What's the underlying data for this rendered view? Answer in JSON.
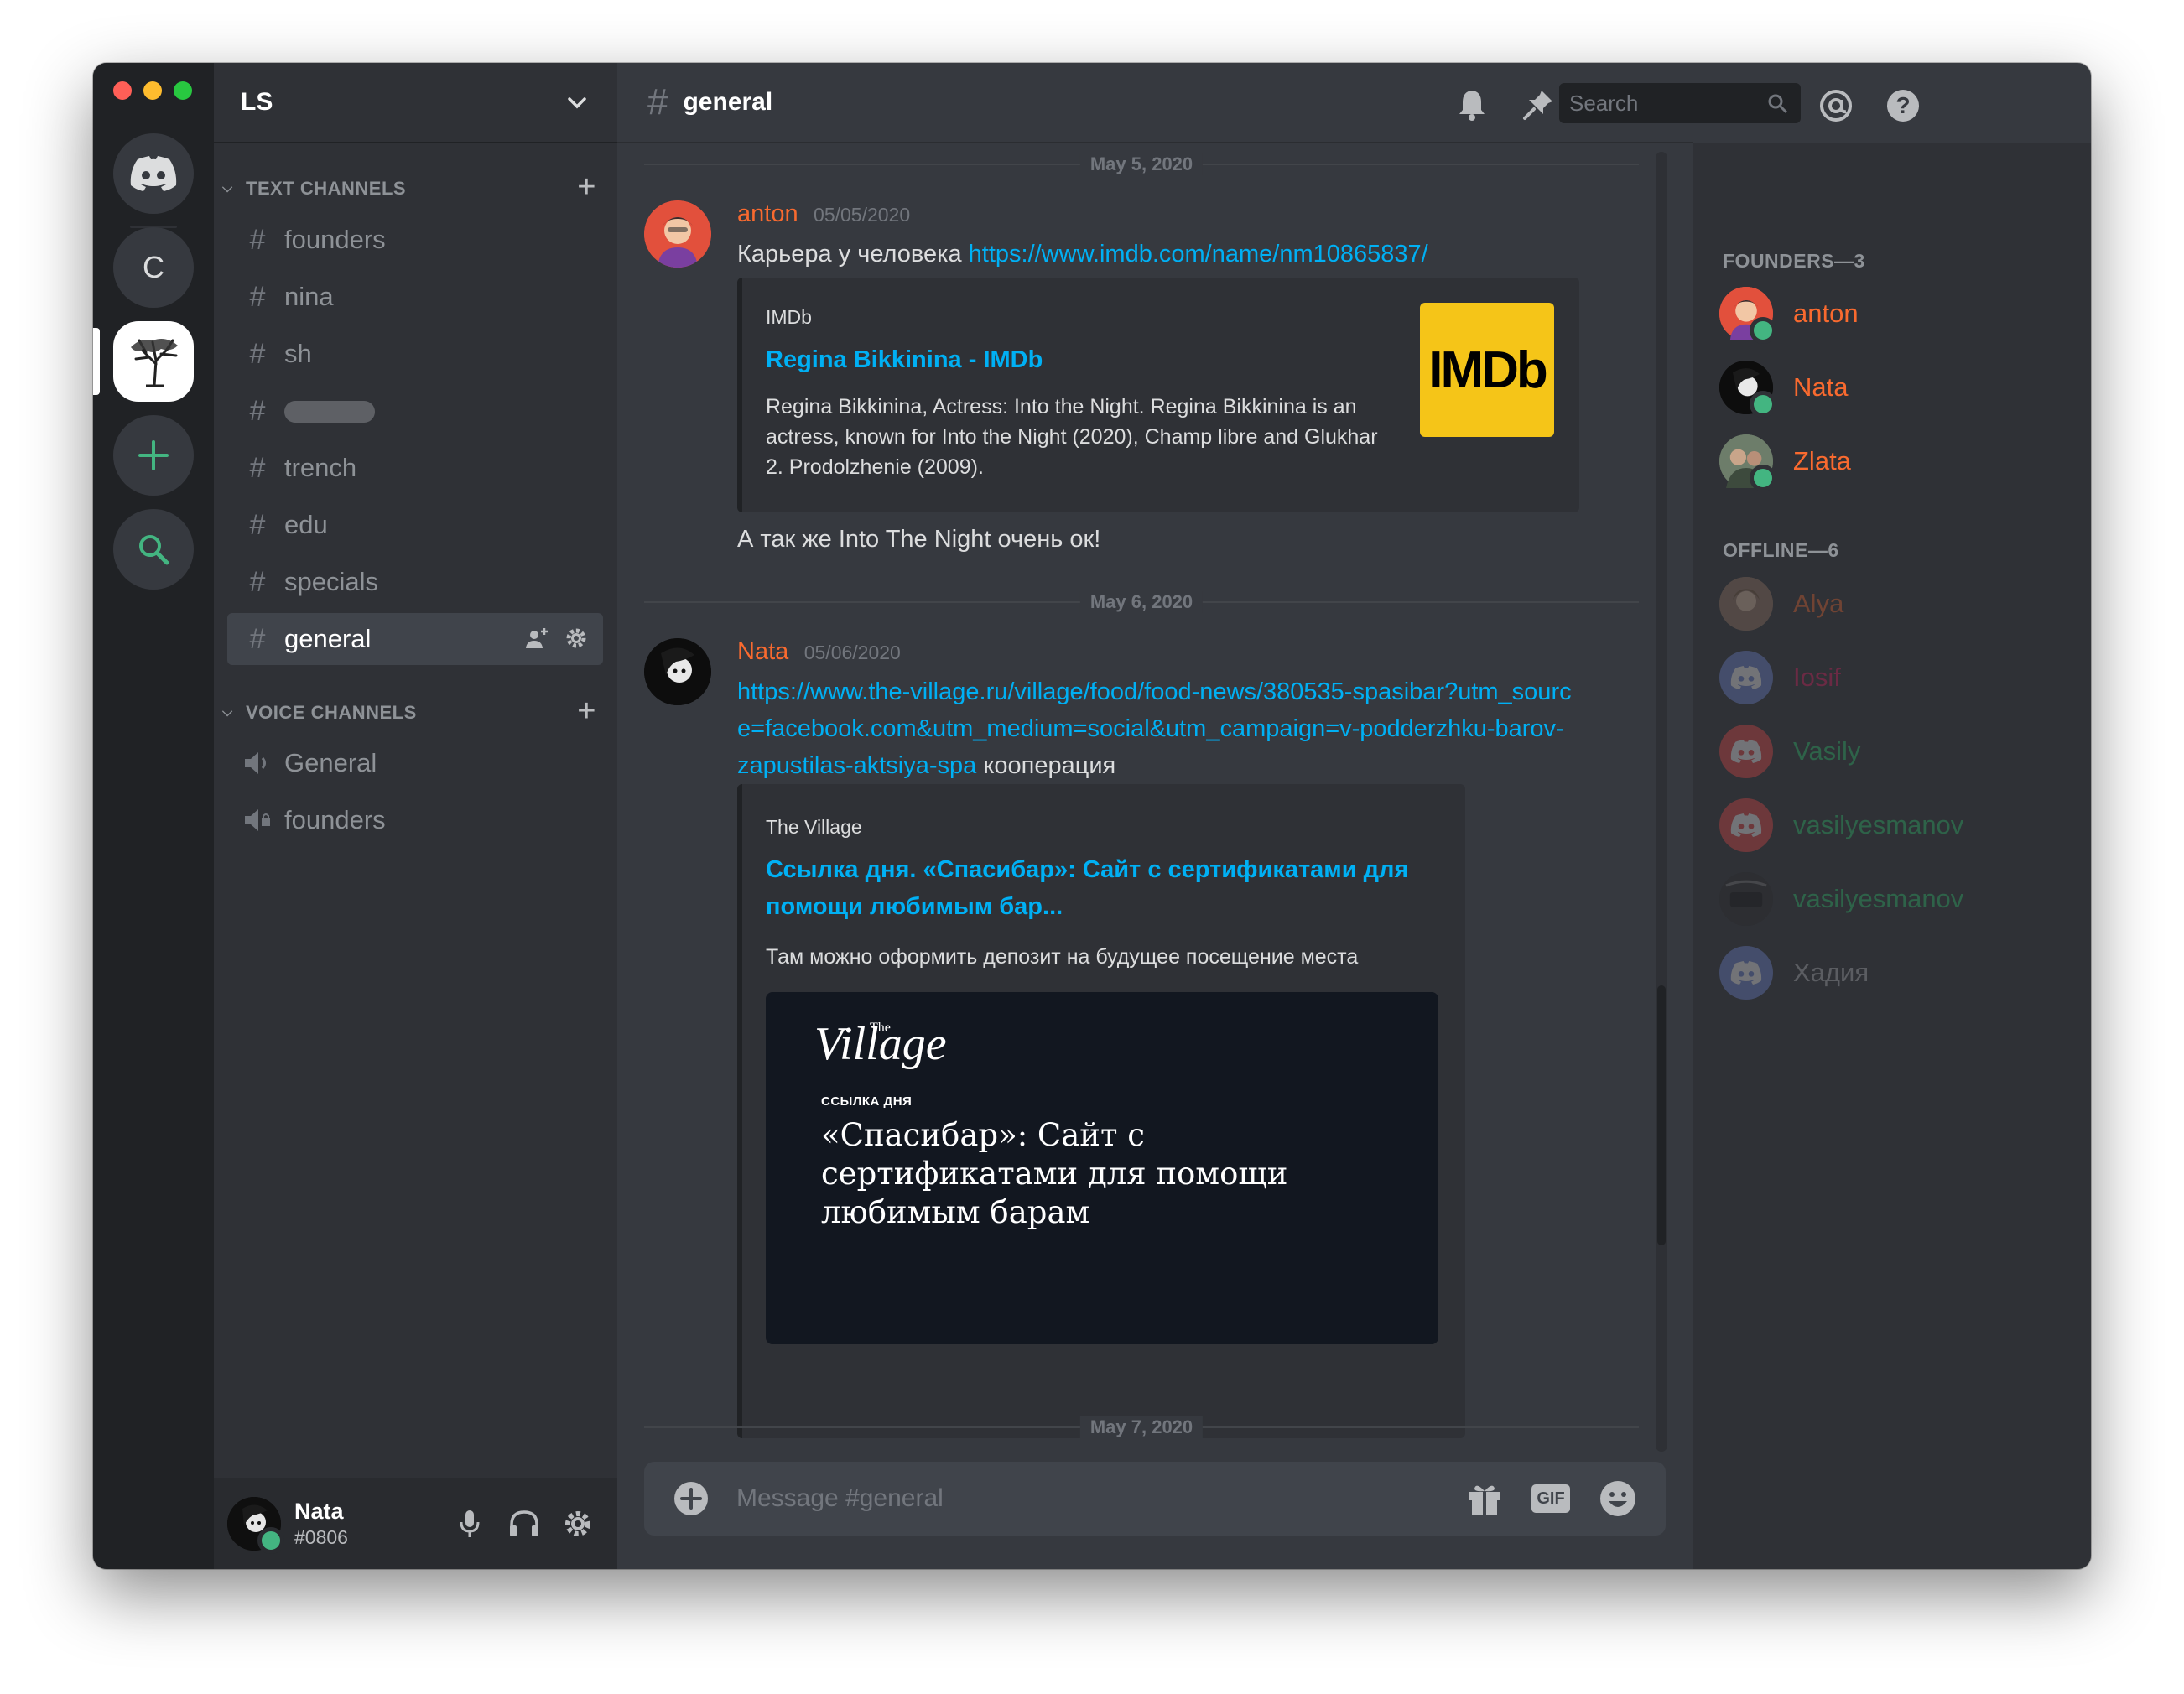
{
  "server": {
    "name": "LS"
  },
  "rail": {
    "server_c_label": "C"
  },
  "categories": {
    "text": "TEXT CHANNELS",
    "voice": "VOICE CHANNELS"
  },
  "text_channels": [
    "founders",
    "nina",
    "sh",
    "",
    "trench",
    "edu",
    "specials",
    "general"
  ],
  "voice_channels": [
    "General",
    "founders"
  ],
  "current_user": {
    "name": "Nata",
    "tag": "#0806"
  },
  "chat": {
    "channel_name": "general",
    "search_placeholder": "Search",
    "composer_placeholder": "Message #general",
    "gif_label": "GIF"
  },
  "messages": {
    "date1": "May 5, 2020",
    "m1": {
      "author": "anton",
      "timestamp": "05/05/2020",
      "text_prefix": "Карьера у человека ",
      "link": "https://www.imdb.com/name/nm10865837/",
      "embed": {
        "provider": "IMDb",
        "title": "Regina Bikkinina - IMDb",
        "description": "Regina Bikkinina, Actress: Into the Night. Regina Bikkinina is an actress, known for Into the Night (2020), Champ libre and Glukhar 2. Prodolzhenie (2009).",
        "thumb_text": "IMDb"
      },
      "followup": "А так же Into The Night очень ок!"
    },
    "date2": "May 6, 2020",
    "m2": {
      "author": "Nata",
      "timestamp": "05/06/2020",
      "link": "https://www.the-village.ru/village/food/food-news/380535-spasibar?utm_source=facebook.com&utm_medium=social&utm_campaign=v-podderzhku-barov-zapustilas-aktsiya-spa",
      "text_suffix": " кооперация",
      "embed": {
        "provider": "The Village",
        "title": "Ссылка дня. «Спасибар»: Сайт с сертификатами для помощи любимым бар...",
        "description": "Там можно оформить депозит на будущее посещение места",
        "image_logo": "Village",
        "image_logo_small": "The",
        "image_kicker": "ССЫЛКА ДНЯ",
        "image_headline": "«Спасибар»: Сайт с сертификатами для помощи любимым барам"
      }
    },
    "date3": "May 7, 2020"
  },
  "members": {
    "founders_header": "FOUNDERS—3",
    "founders": [
      "anton",
      "Nata",
      "Zlata"
    ],
    "offline_header": "OFFLINE—6",
    "offline": [
      "Alya",
      "Iosif",
      "Vasily",
      "vasilyesmanov",
      "vasilyesmanov",
      "Хадия"
    ]
  },
  "colors": {
    "accent": "#7289da",
    "link": "#00b0f4",
    "founder_name": "#f96a2f",
    "online": "#43b581",
    "add_server": "#43b581"
  }
}
